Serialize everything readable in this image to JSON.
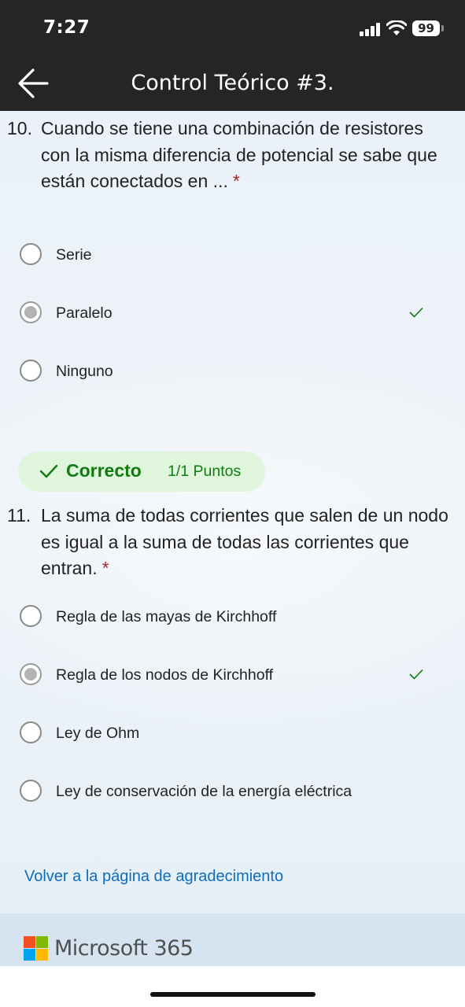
{
  "status_bar": {
    "time": "7:27",
    "battery": "99"
  },
  "nav": {
    "title": "Control Teórico #3."
  },
  "questions": [
    {
      "number": "10.",
      "text": "Cuando se tiene una combinación de resistores con la misma diferencia de potencial se sabe que están conectados en ...",
      "required_mark": "*",
      "options": [
        {
          "label": "Serie",
          "selected": false,
          "correct": false
        },
        {
          "label": "Paralelo",
          "selected": true,
          "correct": true
        },
        {
          "label": "Ninguno",
          "selected": false,
          "correct": false
        }
      ],
      "result": {
        "status": "Correcto",
        "points": "1/1 Puntos"
      }
    },
    {
      "number": "11.",
      "text": "La suma de todas corrientes que salen de un nodo es igual a la suma de todas las corrientes que entran.",
      "required_mark": "*",
      "options": [
        {
          "label": "Regla de las mayas de Kirchhoff",
          "selected": false,
          "correct": false
        },
        {
          "label": "Regla de los nodos de Kirchhoff",
          "selected": true,
          "correct": true
        },
        {
          "label": "Ley de Ohm",
          "selected": false,
          "correct": false
        },
        {
          "label": "Ley de conservación de la energía eléctrica",
          "selected": false,
          "correct": false
        }
      ]
    }
  ],
  "back_link": "Volver a la página de agradecimiento",
  "footer": {
    "brand": "Microsoft 365"
  },
  "colors": {
    "correct_green": "#107c10",
    "badge_bg": "#dff6dd",
    "link_blue": "#0f6cbd",
    "required_red": "#a4262c"
  }
}
